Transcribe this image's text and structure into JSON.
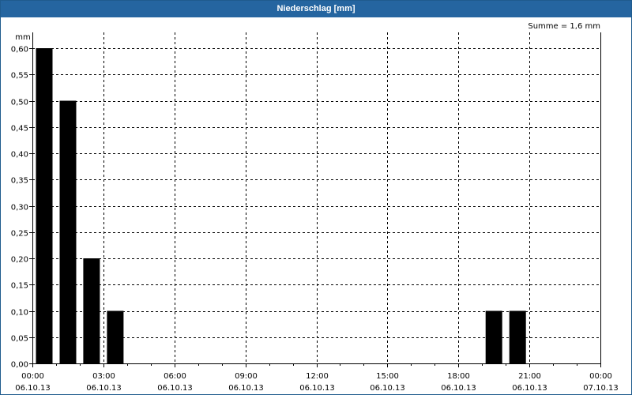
{
  "window": {
    "title": "Niederschlag [mm]"
  },
  "chart_data": {
    "type": "bar",
    "title": "Niederschlag [mm]",
    "ylabel": "mm",
    "xlabel": "",
    "summary": "Summe = 1,6 mm",
    "ylim": [
      0,
      0.6
    ],
    "y_ticks": [
      "0,00",
      "0,05",
      "0,10",
      "0,15",
      "0,20",
      "0,25",
      "0,30",
      "0,35",
      "0,40",
      "0,45",
      "0,50",
      "0,55",
      "0,60"
    ],
    "x_ticks": [
      {
        "time": "00:00",
        "date": "06.10.13"
      },
      {
        "time": "03:00",
        "date": "06.10.13"
      },
      {
        "time": "06:00",
        "date": "06.10.13"
      },
      {
        "time": "09:00",
        "date": "06.10.13"
      },
      {
        "time": "12:00",
        "date": "06.10.13"
      },
      {
        "time": "15:00",
        "date": "06.10.13"
      },
      {
        "time": "18:00",
        "date": "06.10.13"
      },
      {
        "time": "21:00",
        "date": "06.10.13"
      },
      {
        "time": "00:00",
        "date": "07.10.13"
      }
    ],
    "x_range_hours": [
      0,
      24
    ],
    "bars": [
      {
        "hour_start": 0,
        "value": 0.6
      },
      {
        "hour_start": 1,
        "value": 0.5
      },
      {
        "hour_start": 2,
        "value": 0.2
      },
      {
        "hour_start": 3,
        "value": 0.1
      },
      {
        "hour_start": 19,
        "value": 0.1
      },
      {
        "hour_start": 20,
        "value": 0.1
      }
    ],
    "bar_color": "#000000",
    "grid": true,
    "grid_style": "dashed"
  }
}
